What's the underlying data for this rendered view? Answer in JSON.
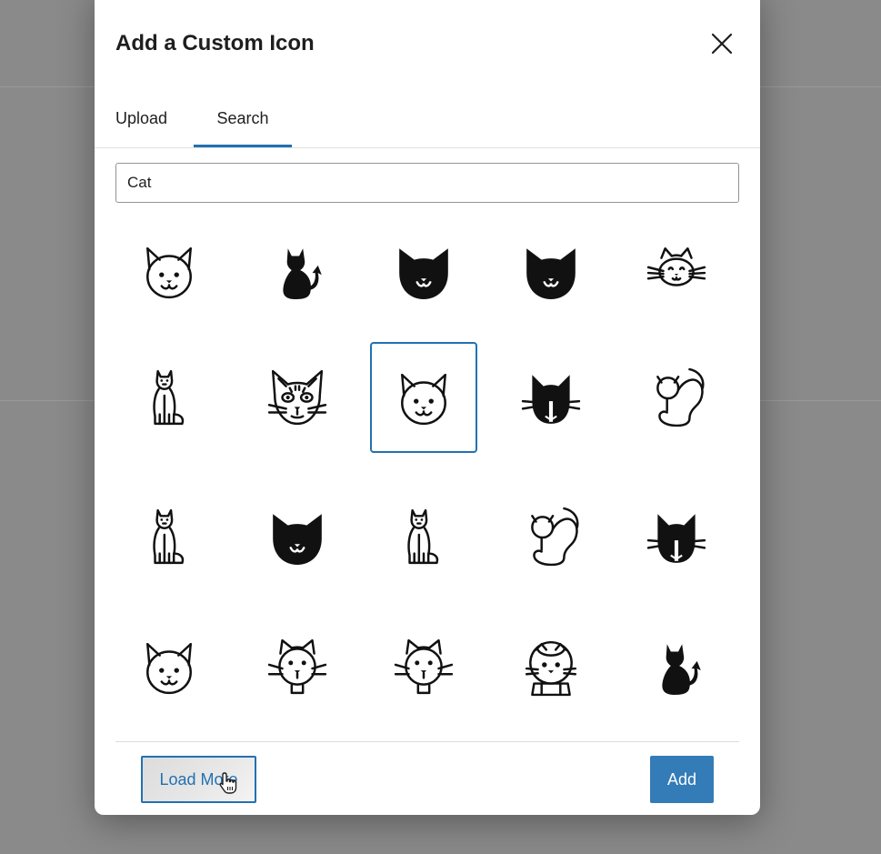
{
  "dialog": {
    "title": "Add a Custom Icon",
    "close_icon": "close-icon"
  },
  "tabs": [
    {
      "label": "Upload",
      "active": false
    },
    {
      "label": "Search",
      "active": true
    }
  ],
  "search": {
    "value": "Cat"
  },
  "icons": [
    {
      "name": "cat-face-outline-icon"
    },
    {
      "name": "cat-sitting-back-solid-icon"
    },
    {
      "name": "cat-face-solid-icon"
    },
    {
      "name": "cat-face-solid-icon"
    },
    {
      "name": "cat-face-whiskers-outline-icon"
    },
    {
      "name": "cat-sitting-outline-icon"
    },
    {
      "name": "cat-face-detailed-outline-icon"
    },
    {
      "name": "cat-face-outline-icon",
      "selected": true
    },
    {
      "name": "cat-face-whiskers-solid-icon"
    },
    {
      "name": "cat-curled-outline-icon"
    },
    {
      "name": "cat-sitting-outline-icon"
    },
    {
      "name": "cat-face-solid-icon"
    },
    {
      "name": "cat-sitting-outline-icon"
    },
    {
      "name": "cat-curled-outline-icon"
    },
    {
      "name": "cat-face-whiskers-solid-icon"
    },
    {
      "name": "cat-face-outline-icon"
    },
    {
      "name": "cat-face-round-whiskers-icon"
    },
    {
      "name": "cat-face-round-whiskers-icon"
    },
    {
      "name": "cat-astronaut-outline-icon"
    },
    {
      "name": "cat-sitting-back-solid-icon"
    }
  ],
  "footer": {
    "load_more_label": "Load More",
    "add_label": "Add"
  },
  "colors": {
    "accent": "#2271b1",
    "backdrop": "#8a8a8a"
  }
}
